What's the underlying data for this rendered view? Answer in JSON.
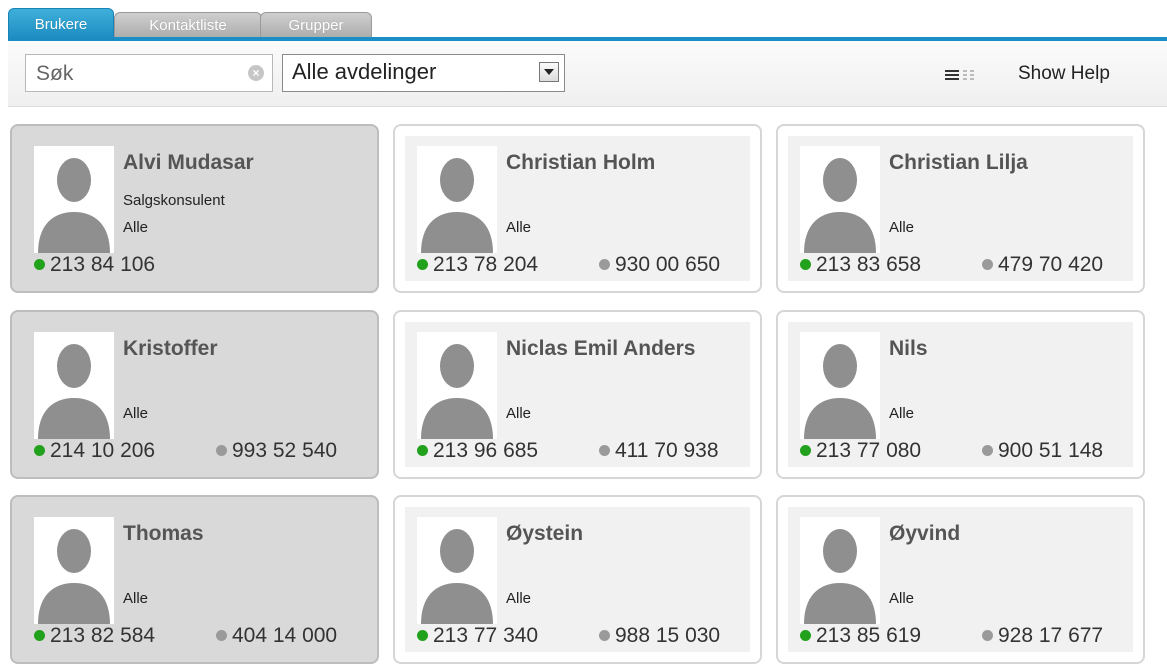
{
  "tabs": [
    {
      "label": "Brukere",
      "active": true
    },
    {
      "label": "Kontaktliste",
      "active": false
    },
    {
      "label": "Grupper",
      "active": false
    }
  ],
  "toolbar": {
    "search_placeholder": "Søk",
    "department_selected": "Alle avdelinger",
    "show_help_label": "Show Help"
  },
  "colors": {
    "accent": "#1a8fc6",
    "status_online": "#22a11c",
    "status_secondary": "#9a9a9a"
  },
  "users": [
    {
      "name": "Alvi Mudasar",
      "title": "Salgskonsulent",
      "department": "Alle",
      "phone1": "213 84 106",
      "phone2": ""
    },
    {
      "name": "Christian Holm",
      "title": "",
      "department": "Alle",
      "phone1": "213 78 204",
      "phone2": "930 00 650"
    },
    {
      "name": "Christian Lilja",
      "title": "",
      "department": "Alle",
      "phone1": "213 83 658",
      "phone2": "479 70 420"
    },
    {
      "name": "Kristoffer",
      "title": "",
      "department": "Alle",
      "phone1": "214 10 206",
      "phone2": "993 52 540"
    },
    {
      "name": "Niclas Emil Anders",
      "title": "",
      "department": "Alle",
      "phone1": "213 96 685",
      "phone2": "411 70 938"
    },
    {
      "name": "Nils",
      "title": "",
      "department": "Alle",
      "phone1": "213 77 080",
      "phone2": "900 51 148"
    },
    {
      "name": "Thomas",
      "title": "",
      "department": "Alle",
      "phone1": "213 82 584",
      "phone2": "404 14 000"
    },
    {
      "name": "Øystein",
      "title": "",
      "department": "Alle",
      "phone1": "213 77 340",
      "phone2": "988 15 030"
    },
    {
      "name": "Øyvind",
      "title": "",
      "department": "Alle",
      "phone1": "213 85 619",
      "phone2": "928 17 677"
    }
  ]
}
